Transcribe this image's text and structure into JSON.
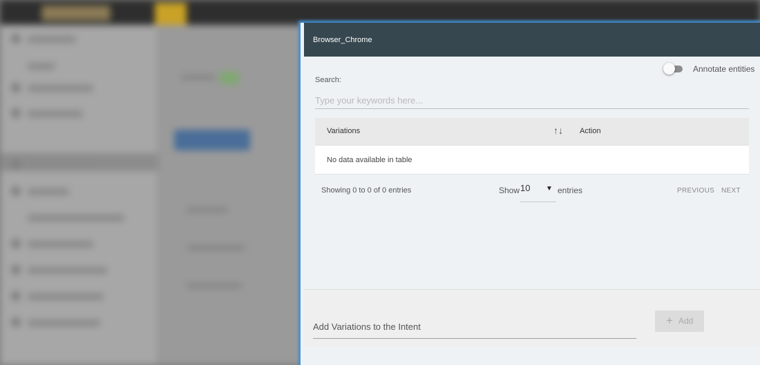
{
  "modal": {
    "title": "Browser_Chrome",
    "annotate_label": "Annotate entities",
    "annotate_on": false,
    "search_label": "Search:",
    "search_placeholder": "Type your keywords here...",
    "table": {
      "columns": [
        "Variations",
        "Action"
      ],
      "sort_icon": "↑↓",
      "empty_text": "No data available in table"
    },
    "info_text": "Showing 0 to 0 of 0 entries",
    "show_label": "Show",
    "page_length": "10",
    "caret": "▼",
    "entries_label": "entries",
    "prev_label": "PREVIOUS",
    "next_label": "NEXT",
    "variation_placeholder": "Add Variations to the Intent",
    "add_icon": "+",
    "add_label": "Add"
  },
  "colors": {
    "header_bg": "#37474f",
    "modal_glow": "#3c8fd6",
    "modal_bg": "#eef2f5"
  },
  "icons": {
    "sort": "sort-icon",
    "caret": "chevron-down-icon",
    "add": "plus-icon"
  }
}
